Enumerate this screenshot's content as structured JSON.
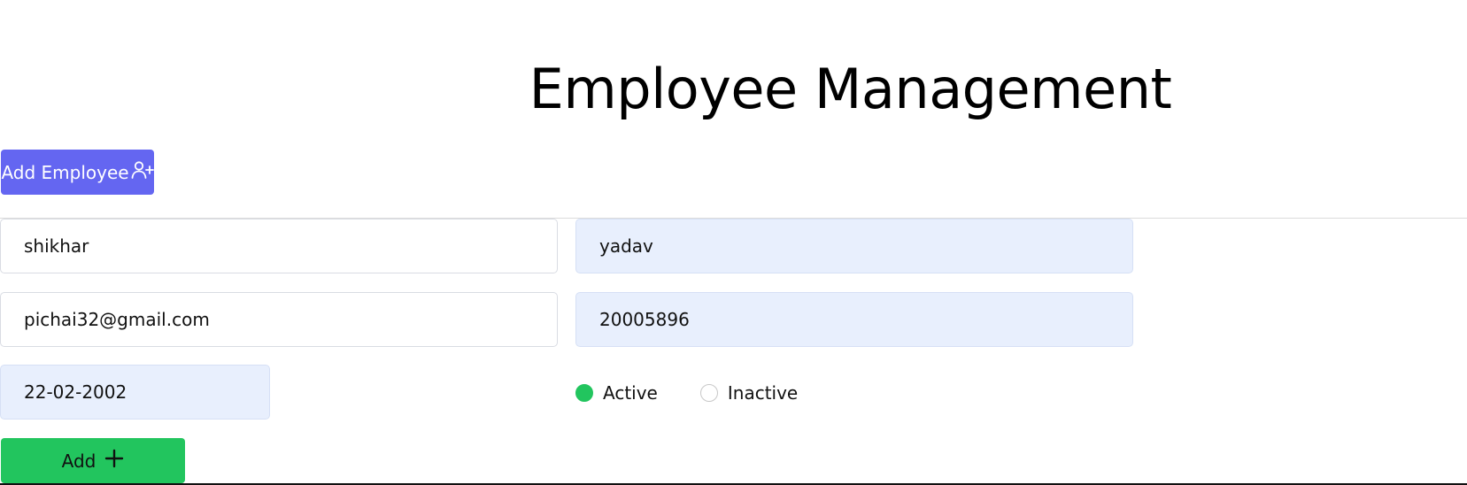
{
  "header": {
    "title": "Employee Management"
  },
  "toolbar": {
    "add_employee_label": "Add Employee",
    "add_employee_icon": "user-plus-icon"
  },
  "form": {
    "first_name": "shikhar",
    "last_name": "yadav",
    "email": "pichai32@gmail.com",
    "phone": "20005896",
    "dob": "22-02-2002",
    "status": {
      "selected": "Active",
      "options": [
        "Active",
        "Inactive"
      ]
    },
    "submit_label": "Add",
    "submit_icon": "plus-icon"
  },
  "colors": {
    "primary": "#6466f1",
    "success": "#22c55e",
    "field_bg": "#e8effd"
  }
}
